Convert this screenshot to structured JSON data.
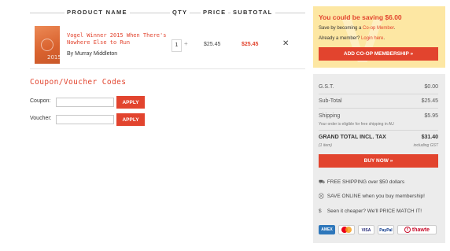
{
  "cart": {
    "headers": {
      "product": "PRODUCT NAME",
      "qty": "QTY",
      "price": "PRICE",
      "subtotal": "SUBTOTAL"
    },
    "item": {
      "cover_year": "2015",
      "title": "Vogel Winner 2015 When There's Nowhere Else to Run",
      "author": "By Murray Middleton",
      "qty": "1",
      "qty_plus": "+",
      "price": "$25.45",
      "subtotal": "$25.45",
      "remove": "✕"
    }
  },
  "coupons": {
    "title": "Coupon/Voucher Codes",
    "coupon_label": "Coupon:",
    "voucher_label": "Voucher:",
    "apply_label": "APPLY",
    "coupon_value": "",
    "voucher_value": ""
  },
  "membership": {
    "title": "You could be saving $6.00",
    "save_text": "Save by becoming a ",
    "save_link": "Co-op Member",
    "save_end": ".",
    "already_text": "Already a member? ",
    "login_link": "Login here",
    "login_end": ".",
    "button": "ADD CO-OP MEMBERSHIP »"
  },
  "totals": {
    "gst_label": "G.S.T.",
    "gst_value": "$0.00",
    "subtotal_label": "Sub-Total",
    "subtotal_value": "$25.45",
    "shipping_label": "Shipping",
    "shipping_value": "$5.95",
    "shipping_note": "Your order is eligible for free shipping in AU",
    "grand_label": "GRAND TOTAL INCL. TAX",
    "grand_value": "$31.40",
    "items_count": "(1 item)",
    "incl_gst": "including GST",
    "buy_button": "BUY NOW »"
  },
  "perks": [
    {
      "icon": "truck-icon",
      "glyph": "⛟",
      "text": "FREE SHIPPING over $50 dollars"
    },
    {
      "icon": "cart-icon",
      "glyph": "⛒",
      "text": "SAVE ONLINE when you buy membership!"
    },
    {
      "icon": "dollar-icon",
      "glyph": "$",
      "text": "Seen it cheaper? We'll PRICE MATCH IT!"
    }
  ],
  "payment": {
    "amex": "AMEX",
    "mastercard": "MC",
    "visa": "VISA",
    "paypal": "PayPal",
    "thawte": "thawte"
  },
  "colors": {
    "accent": "#e2442e",
    "membership_bg": "#fde7a3",
    "totals_bg": "#ececec"
  }
}
